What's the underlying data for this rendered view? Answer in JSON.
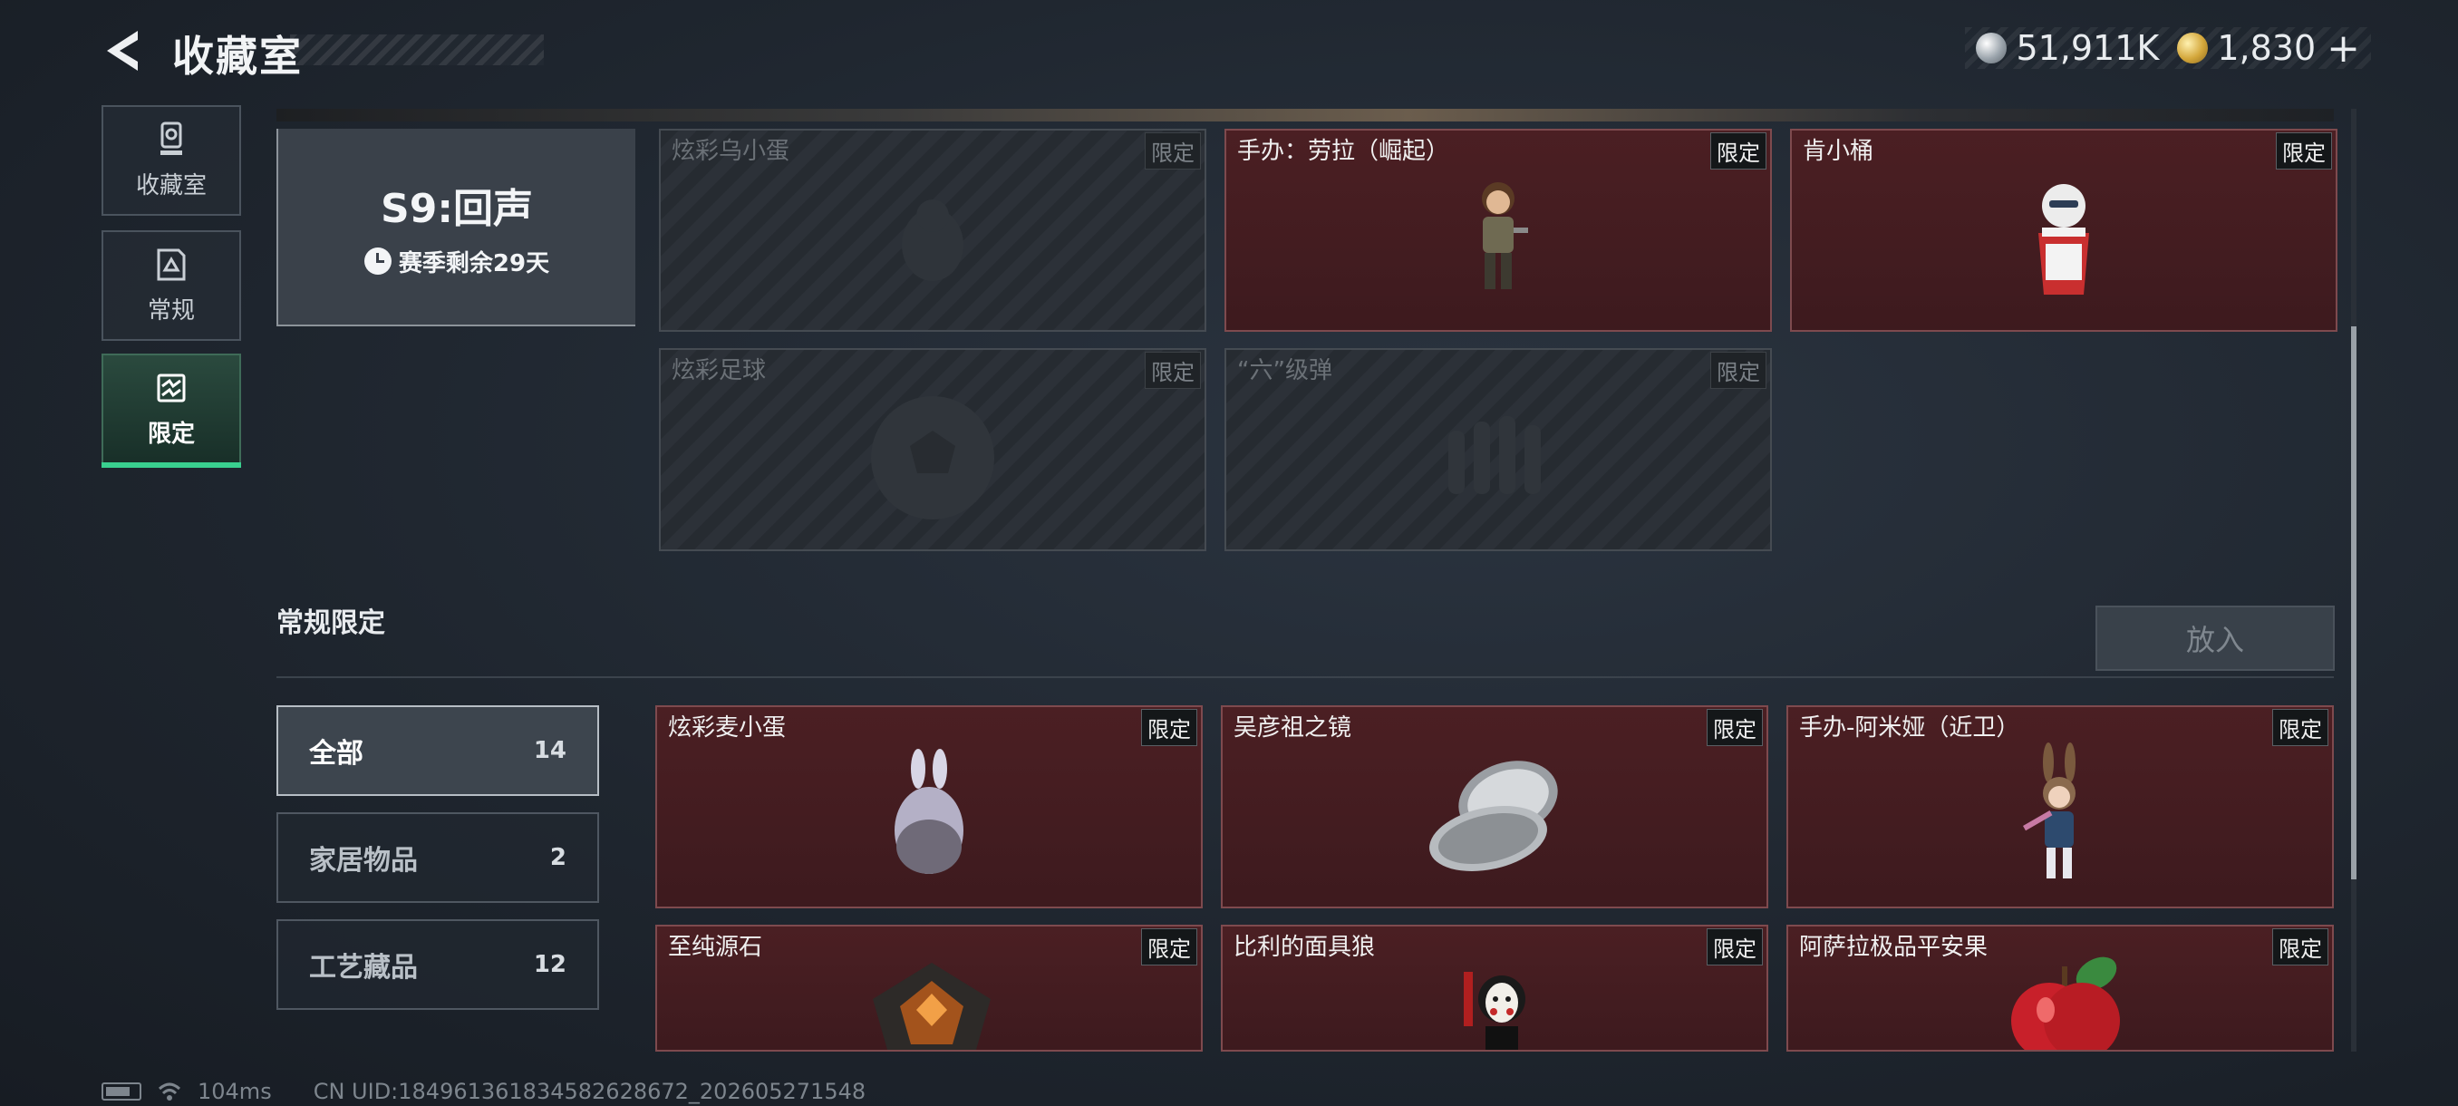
{
  "header": {
    "title": "收藏室",
    "currency_silver": "51,911K",
    "currency_gold": "1,830",
    "plus": "+"
  },
  "nav": [
    {
      "label": "收藏室",
      "icon": "trophy-icon"
    },
    {
      "label": "常规",
      "icon": "document-icon"
    },
    {
      "label": "限定",
      "icon": "limited-icon",
      "active": true
    }
  ],
  "season": {
    "title": "S9:回声",
    "remaining": "赛季剩余29天"
  },
  "season_items": [
    {
      "name": "炫彩乌小蛋",
      "tag": "限定",
      "owned": false
    },
    {
      "name": "手办：劳拉（崛起）",
      "tag": "限定",
      "owned": true
    },
    {
      "name": "肯小桶",
      "tag": "限定",
      "owned": true
    },
    {
      "name": "炫彩足球",
      "tag": "限定",
      "owned": false
    },
    {
      "name": "“六”级弹",
      "tag": "限定",
      "owned": false
    }
  ],
  "regular": {
    "title": "常规限定",
    "put_button": "放入",
    "filters": [
      {
        "label": "全部",
        "count": "14",
        "active": true
      },
      {
        "label": "家居物品",
        "count": "2"
      },
      {
        "label": "工艺藏品",
        "count": "12"
      }
    ],
    "items": [
      {
        "name": "炫彩麦小蛋",
        "tag": "限定"
      },
      {
        "name": "吴彦祖之镜",
        "tag": "限定"
      },
      {
        "name": "手办-阿米娅（近卫）",
        "tag": "限定"
      },
      {
        "name": "至纯源石",
        "tag": "限定"
      },
      {
        "name": "比利的面具狼",
        "tag": "限定"
      },
      {
        "name": "阿萨拉极品平安果",
        "tag": "限定"
      }
    ]
  },
  "status": {
    "ping": "104ms",
    "uid": "CN UID:184961361834582628672_202605271548"
  },
  "colors": {
    "accent": "#39d08f",
    "owned_card": "#4b1f23",
    "locked_card": "#262b31"
  }
}
